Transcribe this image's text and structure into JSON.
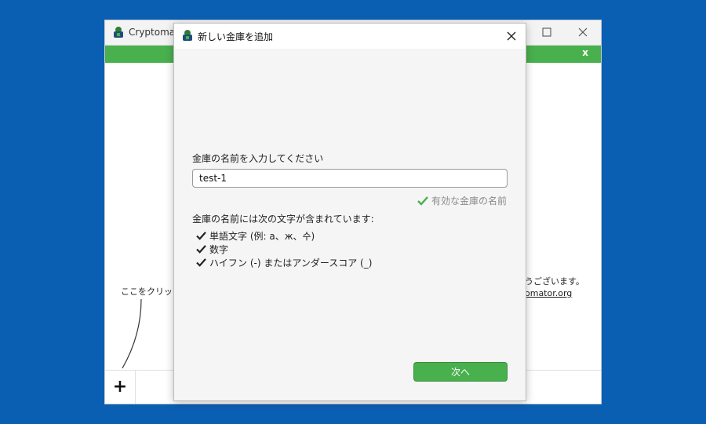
{
  "background_app": {
    "title_partial": "Cryptomato",
    "hint_left": "ここをクリックし",
    "hint_right_line1": "うございます。",
    "hint_right_line2": "omator.org",
    "add_button": "+",
    "greenbar_close": "x"
  },
  "dialog": {
    "title": "新しい金庫を追加",
    "name_label": "金庫の名前を入力してください",
    "name_value": "test-1",
    "valid_message": "有効な金庫の名前",
    "contains_label": "金庫の名前には次の文字が含まれています:",
    "rules": [
      "単語文字 (例: a、ж、수)",
      "数字",
      "ハイフン (-) またはアンダースコア (_)"
    ],
    "next_button": "次へ"
  },
  "colors": {
    "desktop": "#0b5fb3",
    "accent_green": "#49b04e",
    "check_green": "#49b04e"
  }
}
